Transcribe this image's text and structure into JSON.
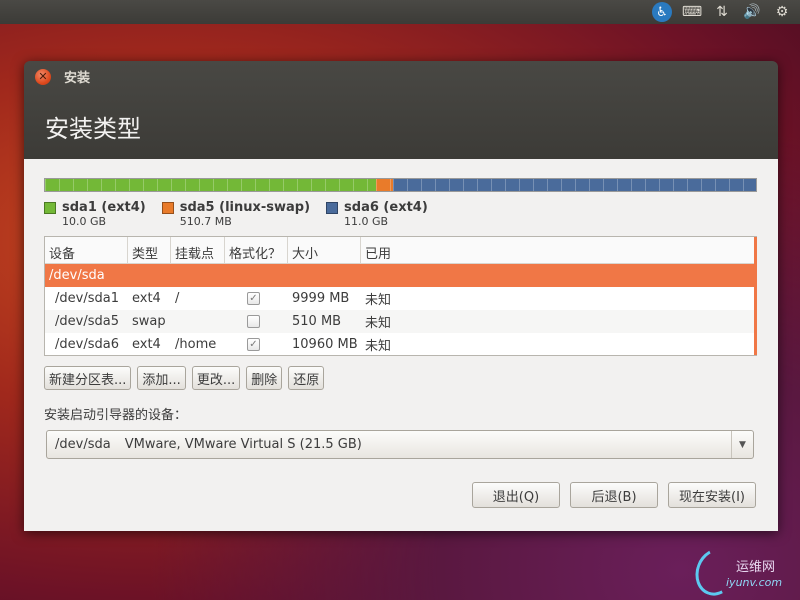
{
  "window": {
    "title": "安装",
    "heading": "安装类型"
  },
  "partitions": [
    {
      "name": "sda1 (ext4)",
      "size": "10.0 GB",
      "color": "#73b837",
      "share": 0.465
    },
    {
      "name": "sda5 (linux-swap)",
      "size": "510.7 MB",
      "color": "#e97b2a",
      "share": 0.024
    },
    {
      "name": "sda6 (ext4)",
      "size": "11.0 GB",
      "color": "#4a6b9b",
      "share": 0.511
    }
  ],
  "table": {
    "headers": [
      "设备",
      "类型",
      "挂载点",
      "格式化？",
      "大小",
      "已用"
    ],
    "device_row": "/dev/sda",
    "rows": [
      {
        "device": "/dev/sda1",
        "type": "ext4",
        "mount": "/",
        "format": true,
        "size": "9999 MB",
        "used": "未知"
      },
      {
        "device": "/dev/sda5",
        "type": "swap",
        "mount": "",
        "format": false,
        "size": "510 MB",
        "used": "未知"
      },
      {
        "device": "/dev/sda6",
        "type": "ext4",
        "mount": "/home",
        "format": true,
        "size": "10960 MB",
        "used": "未知"
      }
    ]
  },
  "buttons": {
    "new_table": "新建分区表...",
    "add": "添加...",
    "change": "更改...",
    "delete": "删除",
    "revert": "还原"
  },
  "boot": {
    "label": "安装启动引导器的设备：",
    "device": "/dev/sda",
    "desc": "VMware, VMware Virtual S (21.5 GB)"
  },
  "actions": {
    "quit": "退出(Q)",
    "back": "后退(B)",
    "install": "现在安装(I)"
  },
  "watermark": {
    "text": "运维网",
    "sub": "iyunv.com"
  },
  "colors": {
    "accent": "#f07746",
    "panel": "#3c3b37"
  }
}
